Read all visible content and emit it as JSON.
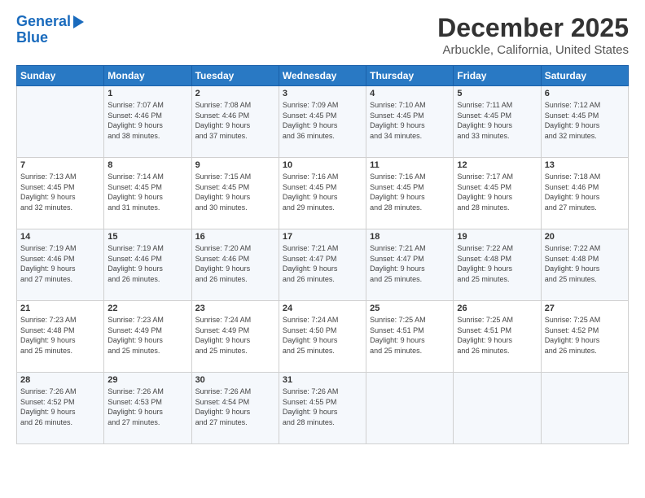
{
  "header": {
    "logo_line1": "General",
    "logo_line2": "Blue",
    "main_title": "December 2025",
    "subtitle": "Arbuckle, California, United States"
  },
  "days_of_week": [
    "Sunday",
    "Monday",
    "Tuesday",
    "Wednesday",
    "Thursday",
    "Friday",
    "Saturday"
  ],
  "weeks": [
    [
      {
        "day": "",
        "sunrise": "",
        "sunset": "",
        "daylight": ""
      },
      {
        "day": "1",
        "sunrise": "Sunrise: 7:07 AM",
        "sunset": "Sunset: 4:46 PM",
        "daylight": "Daylight: 9 hours and 38 minutes."
      },
      {
        "day": "2",
        "sunrise": "Sunrise: 7:08 AM",
        "sunset": "Sunset: 4:46 PM",
        "daylight": "Daylight: 9 hours and 37 minutes."
      },
      {
        "day": "3",
        "sunrise": "Sunrise: 7:09 AM",
        "sunset": "Sunset: 4:45 PM",
        "daylight": "Daylight: 9 hours and 36 minutes."
      },
      {
        "day": "4",
        "sunrise": "Sunrise: 7:10 AM",
        "sunset": "Sunset: 4:45 PM",
        "daylight": "Daylight: 9 hours and 34 minutes."
      },
      {
        "day": "5",
        "sunrise": "Sunrise: 7:11 AM",
        "sunset": "Sunset: 4:45 PM",
        "daylight": "Daylight: 9 hours and 33 minutes."
      },
      {
        "day": "6",
        "sunrise": "Sunrise: 7:12 AM",
        "sunset": "Sunset: 4:45 PM",
        "daylight": "Daylight: 9 hours and 32 minutes."
      }
    ],
    [
      {
        "day": "7",
        "sunrise": "Sunrise: 7:13 AM",
        "sunset": "Sunset: 4:45 PM",
        "daylight": "Daylight: 9 hours and 32 minutes."
      },
      {
        "day": "8",
        "sunrise": "Sunrise: 7:14 AM",
        "sunset": "Sunset: 4:45 PM",
        "daylight": "Daylight: 9 hours and 31 minutes."
      },
      {
        "day": "9",
        "sunrise": "Sunrise: 7:15 AM",
        "sunset": "Sunset: 4:45 PM",
        "daylight": "Daylight: 9 hours and 30 minutes."
      },
      {
        "day": "10",
        "sunrise": "Sunrise: 7:16 AM",
        "sunset": "Sunset: 4:45 PM",
        "daylight": "Daylight: 9 hours and 29 minutes."
      },
      {
        "day": "11",
        "sunrise": "Sunrise: 7:16 AM",
        "sunset": "Sunset: 4:45 PM",
        "daylight": "Daylight: 9 hours and 28 minutes."
      },
      {
        "day": "12",
        "sunrise": "Sunrise: 7:17 AM",
        "sunset": "Sunset: 4:45 PM",
        "daylight": "Daylight: 9 hours and 28 minutes."
      },
      {
        "day": "13",
        "sunrise": "Sunrise: 7:18 AM",
        "sunset": "Sunset: 4:46 PM",
        "daylight": "Daylight: 9 hours and 27 minutes."
      }
    ],
    [
      {
        "day": "14",
        "sunrise": "Sunrise: 7:19 AM",
        "sunset": "Sunset: 4:46 PM",
        "daylight": "Daylight: 9 hours and 27 minutes."
      },
      {
        "day": "15",
        "sunrise": "Sunrise: 7:19 AM",
        "sunset": "Sunset: 4:46 PM",
        "daylight": "Daylight: 9 hours and 26 minutes."
      },
      {
        "day": "16",
        "sunrise": "Sunrise: 7:20 AM",
        "sunset": "Sunset: 4:46 PM",
        "daylight": "Daylight: 9 hours and 26 minutes."
      },
      {
        "day": "17",
        "sunrise": "Sunrise: 7:21 AM",
        "sunset": "Sunset: 4:47 PM",
        "daylight": "Daylight: 9 hours and 26 minutes."
      },
      {
        "day": "18",
        "sunrise": "Sunrise: 7:21 AM",
        "sunset": "Sunset: 4:47 PM",
        "daylight": "Daylight: 9 hours and 25 minutes."
      },
      {
        "day": "19",
        "sunrise": "Sunrise: 7:22 AM",
        "sunset": "Sunset: 4:48 PM",
        "daylight": "Daylight: 9 hours and 25 minutes."
      },
      {
        "day": "20",
        "sunrise": "Sunrise: 7:22 AM",
        "sunset": "Sunset: 4:48 PM",
        "daylight": "Daylight: 9 hours and 25 minutes."
      }
    ],
    [
      {
        "day": "21",
        "sunrise": "Sunrise: 7:23 AM",
        "sunset": "Sunset: 4:48 PM",
        "daylight": "Daylight: 9 hours and 25 minutes."
      },
      {
        "day": "22",
        "sunrise": "Sunrise: 7:23 AM",
        "sunset": "Sunset: 4:49 PM",
        "daylight": "Daylight: 9 hours and 25 minutes."
      },
      {
        "day": "23",
        "sunrise": "Sunrise: 7:24 AM",
        "sunset": "Sunset: 4:49 PM",
        "daylight": "Daylight: 9 hours and 25 minutes."
      },
      {
        "day": "24",
        "sunrise": "Sunrise: 7:24 AM",
        "sunset": "Sunset: 4:50 PM",
        "daylight": "Daylight: 9 hours and 25 minutes."
      },
      {
        "day": "25",
        "sunrise": "Sunrise: 7:25 AM",
        "sunset": "Sunset: 4:51 PM",
        "daylight": "Daylight: 9 hours and 25 minutes."
      },
      {
        "day": "26",
        "sunrise": "Sunrise: 7:25 AM",
        "sunset": "Sunset: 4:51 PM",
        "daylight": "Daylight: 9 hours and 26 minutes."
      },
      {
        "day": "27",
        "sunrise": "Sunrise: 7:25 AM",
        "sunset": "Sunset: 4:52 PM",
        "daylight": "Daylight: 9 hours and 26 minutes."
      }
    ],
    [
      {
        "day": "28",
        "sunrise": "Sunrise: 7:26 AM",
        "sunset": "Sunset: 4:52 PM",
        "daylight": "Daylight: 9 hours and 26 minutes."
      },
      {
        "day": "29",
        "sunrise": "Sunrise: 7:26 AM",
        "sunset": "Sunset: 4:53 PM",
        "daylight": "Daylight: 9 hours and 27 minutes."
      },
      {
        "day": "30",
        "sunrise": "Sunrise: 7:26 AM",
        "sunset": "Sunset: 4:54 PM",
        "daylight": "Daylight: 9 hours and 27 minutes."
      },
      {
        "day": "31",
        "sunrise": "Sunrise: 7:26 AM",
        "sunset": "Sunset: 4:55 PM",
        "daylight": "Daylight: 9 hours and 28 minutes."
      },
      {
        "day": "",
        "sunrise": "",
        "sunset": "",
        "daylight": ""
      },
      {
        "day": "",
        "sunrise": "",
        "sunset": "",
        "daylight": ""
      },
      {
        "day": "",
        "sunrise": "",
        "sunset": "",
        "daylight": ""
      }
    ]
  ]
}
